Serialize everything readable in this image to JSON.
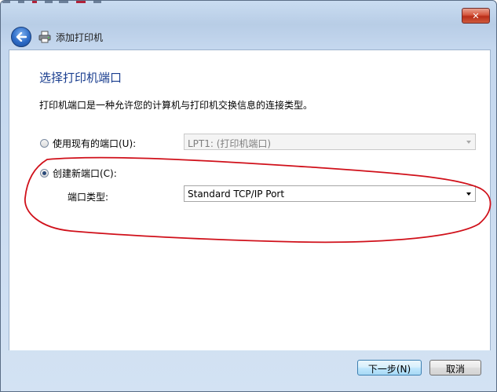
{
  "window": {
    "nav_title": "添加打印机",
    "close_symbol": "✕"
  },
  "page": {
    "heading": "选择打印机端口",
    "description": "打印机端口是一种允许您的计算机与打印机交换信息的连接类型。"
  },
  "options": {
    "existing_port": {
      "label": "使用现有的端口(U):",
      "selected": false,
      "dropdown_value": "LPT1: (打印机端口)",
      "enabled": false
    },
    "new_port": {
      "label": "创建新端口(C):",
      "selected": true,
      "type_label": "端口类型:",
      "dropdown_value": "Standard TCP/IP Port",
      "enabled": true
    }
  },
  "buttons": {
    "next": "下一步(N)",
    "cancel": "取消"
  },
  "colors": {
    "heading": "#1a3e8f",
    "annotation": "#d0101a",
    "close_button": "#c8432c"
  },
  "icons": [
    "back-arrow-icon",
    "printer-icon",
    "close-icon",
    "chevron-down-icon"
  ]
}
